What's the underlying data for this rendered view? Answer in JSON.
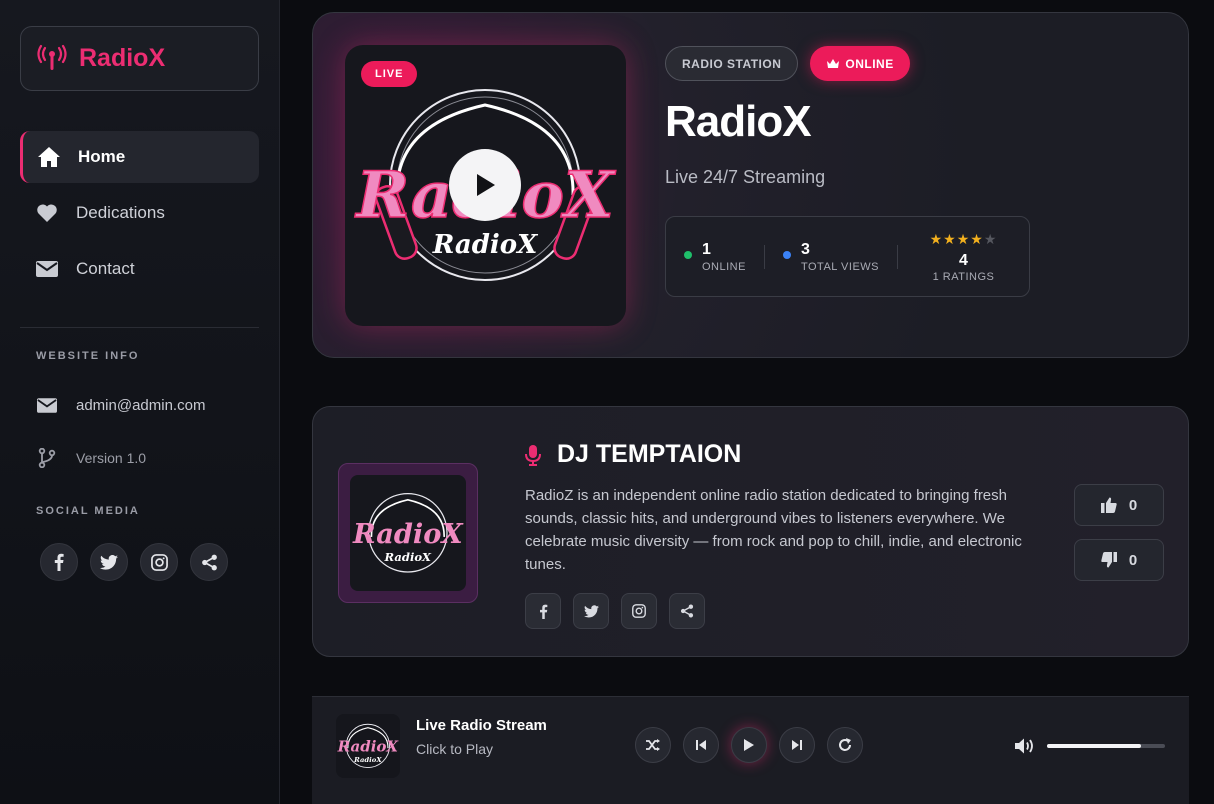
{
  "brand": {
    "name": "RadioX",
    "accent": "#ec2d72"
  },
  "nav": [
    {
      "label": "Home",
      "icon": "home-icon",
      "active": true
    },
    {
      "label": "Dedications",
      "icon": "heart-icon",
      "active": false
    },
    {
      "label": "Contact",
      "icon": "envelope-icon",
      "active": false
    }
  ],
  "website_info": {
    "title": "WEBSITE INFO",
    "email": "admin@admin.com",
    "version": "Version 1.0"
  },
  "social_media": {
    "title": "SOCIAL MEDIA",
    "icons": [
      "facebook-icon",
      "twitter-icon",
      "instagram-icon",
      "share-icon"
    ]
  },
  "hero": {
    "live_badge": "LIVE",
    "cover_text": "RadioX",
    "category_badge": "RADIO STATION",
    "status_badge": "ONLINE",
    "title": "RadioX",
    "subtitle": "Live 24/7 Streaming",
    "stats": {
      "online": {
        "value": "1",
        "label": "ONLINE",
        "color": "#1fbf6a"
      },
      "views": {
        "value": "3",
        "label": "TOTAL VIEWS",
        "color": "#3b82f6"
      },
      "rating": {
        "stars": 4,
        "max": 5,
        "value": "4",
        "label": "1 RATINGS",
        "star_color": "#f2b01e"
      }
    }
  },
  "dj": {
    "name": "DJ TEMPTAION",
    "description": "RadioZ is an independent online radio station dedicated to bringing fresh sounds, classic hits, and underground vibes to listeners everywhere. We celebrate music diversity — from rock and pop to chill, indie, and electronic tunes.",
    "likes": "0",
    "dislikes": "0"
  },
  "player": {
    "title": "Live Radio Stream",
    "subtitle": "Click to Play",
    "volume": 0.8
  }
}
